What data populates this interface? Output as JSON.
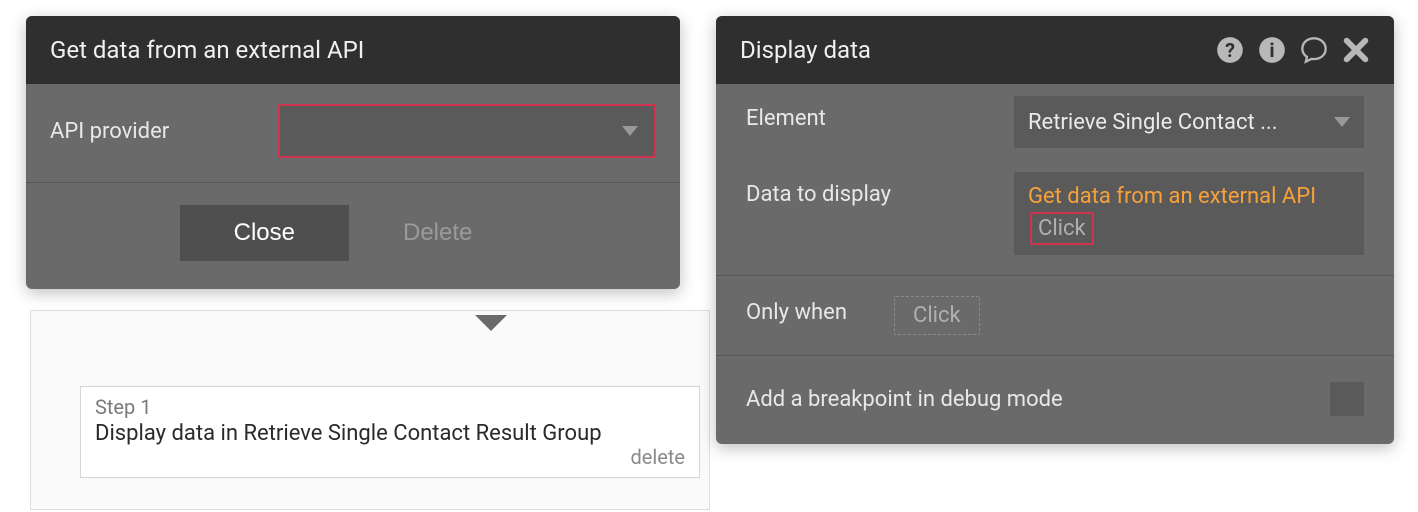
{
  "left_panel": {
    "title": "Get data from an external API",
    "fields": {
      "api_provider_label": "API provider",
      "api_provider_value": ""
    },
    "buttons": {
      "close": "Close",
      "delete": "Delete"
    }
  },
  "step_card": {
    "step_label": "Step 1",
    "step_title": "Display data in Retrieve Single Contact Result Group",
    "delete": "delete"
  },
  "right_panel": {
    "title": "Display data",
    "fields": {
      "element_label": "Element",
      "element_value": "Retrieve Single Contact ...",
      "data_to_display_label": "Data to display",
      "data_to_display_expr": "Get data from an external API",
      "data_to_display_token": "Click",
      "only_when_label": "Only when",
      "only_when_token": "Click",
      "breakpoint_label": "Add a breakpoint in debug mode"
    }
  },
  "colors": {
    "error_border": "#d0334f",
    "accent": "#f7a13a"
  }
}
